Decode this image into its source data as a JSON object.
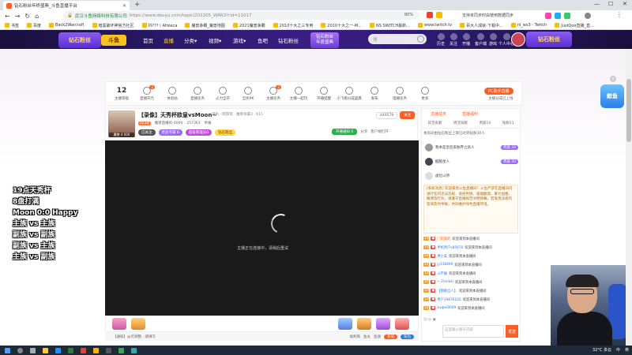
{
  "browser": {
    "tab_title": "钻石粉丝年终盛典_斗鱼直播平台",
    "new_tab_symbol": "+",
    "url_prefix": "武汉斗鱼网络科技有限公司",
    "url": "https://www.douyu.com/topic/202205_WAR3?rid=11017",
    "zoom": "80%",
    "ext_label": "支持未同步时由使用数据同步",
    "bookmarks": [
      "书签",
      "百度",
      "Back2Warcraft",
      "暗黑破坏神官方社区",
      "抖???丨Afreeca",
      "魔兽争霸_魔兽地图",
      "2021魔兽争霸",
      "2010十大之三专用",
      "2010十大之一-M...",
      "NS SWITCH最新...",
      "www.twitch.tv",
      "百大人成就-下载中...",
      "nl_ws3 - Twitch",
      "JustQoo直播_直..."
    ]
  },
  "header": {
    "logo_left": "钻石粉丝",
    "logo_badge": "斗鱼",
    "nav": [
      "首页",
      "直播",
      "分类▾",
      "视频▾",
      "游戏▾",
      "鱼吧",
      "钻石粉丝"
    ],
    "promo": [
      "钻石粉丝",
      "年度盛典"
    ],
    "search_placeholder": "搜",
    "icons": [
      "历史",
      "关注",
      "开播",
      "客户端",
      "游戏",
      "个人中心"
    ],
    "logo_right": "钻石粉丝"
  },
  "toolbar": {
    "level_num": "12",
    "level_label": "主播等级",
    "items": [
      "直播开元",
      "体验站",
      "直播任务",
      "火力全开",
      "全民PK",
      "主播任务",
      "主播一起玩",
      "开播提醒",
      "小飞猪分成盛典",
      "发布",
      "电播任务",
      "更多"
    ],
    "badges": [
      "2",
      "2"
    ],
    "pc_button": "PC助手直播",
    "right_label": "主播分成已上线"
  },
  "room": {
    "title": "【录像】天秀杯欧皇vsMoon~",
    "tags": "单机 · 网游戏 · 魔兽争霸3 · 615",
    "level_badge": "LV.14",
    "anchor_id": "魔兽直播ID 6000",
    "followers": "257363",
    "report": "举报",
    "tag_pills": [
      "已关注",
      "贵族专属 8",
      "超级管理员0",
      "钻石粉丝"
    ],
    "stats": [
      "449579",
      "关注"
    ],
    "share": "分享",
    "client": "客户端打开",
    "green_btn": "开播通知 0",
    "anchor_name": "魔兽 4 000"
  },
  "video": {
    "message": "主播正在连接中，请稍后重试",
    "bottom_left": "【通知】@可调整…请填写",
    "bottom_right": [
      "福利购",
      "鱼丸",
      "鱼翅",
      "充值",
      "背包"
    ]
  },
  "panel": {
    "top": [
      "主播任务",
      "直播福利"
    ],
    "tabs": [
      "日活贡献",
      "周活贡献",
      "贵族14",
      "钻粉11"
    ],
    "notice": "本房间由钻石粉丝上限已达到钻粉30人",
    "ranks": [
      {
        "name": "我本是皇后皮肤弃之高人",
        "badge": "贵族 30"
      },
      {
        "name": "酷酷星人",
        "badge": "贵族 30"
      },
      {
        "name": "虚位以待",
        "badge": ""
      }
    ],
    "system_msg": "[系统消息] 欢迎来到斗鱼直播间！斗鱼严禁在直播间内进行任何违法违规、低俗色情、吸烟酗酒、暴力血腥、赌博等行为，请遵守直播规范文明弹幕，若发现违规内容请及时举报，共同维护绿色直播环境。",
    "chats": [
      {
        "lv": "13",
        "name": "门前面的",
        "msg": "欢迎来到本直播间",
        "orange": true
      },
      {
        "lv": "13",
        "name": "手机用户s85670",
        "msg": "欢迎来到本直播间",
        "orange": false
      },
      {
        "lv": "22",
        "name": "用小美",
        "msg": "欢迎来到本直播间",
        "orange": false
      },
      {
        "lv": "12",
        "name": "jy138469",
        "msg": "欢迎来到本直播间",
        "orange": false
      },
      {
        "lv": "13",
        "name": "斗不服",
        "msg": "欢迎来到本直播间",
        "orange": false
      },
      {
        "lv": "15",
        "name": "~ Zenlaki",
        "msg": "欢迎来到本直播间",
        "orange": false
      },
      {
        "lv": "15",
        "name": "【我顾自人】",
        "msg": "欢迎来到本直播间",
        "orange": false
      },
      {
        "lv": "13",
        "name": "用户19876105",
        "msg": "欢迎来到本直播间",
        "orange": false
      },
      {
        "lv": "12",
        "name": "xuqlei9009",
        "msg": "欢迎来到本直播间",
        "orange": false
      }
    ],
    "input_placeholder": "这里输入聊天内容",
    "send": "发送"
  },
  "overlay_lines": [
    "19点天秀杯",
    "8盘打满",
    "Moon 0:0 Happy",
    "主族 vs 主族",
    "副族 vs 副族",
    "副族 vs 主族",
    "主族 vs 副族"
  ],
  "float_badge": "鲸鱼",
  "taskbar": {
    "weather": "32°C 多云",
    "lang": "英",
    "time": "",
    "ime": "中"
  }
}
